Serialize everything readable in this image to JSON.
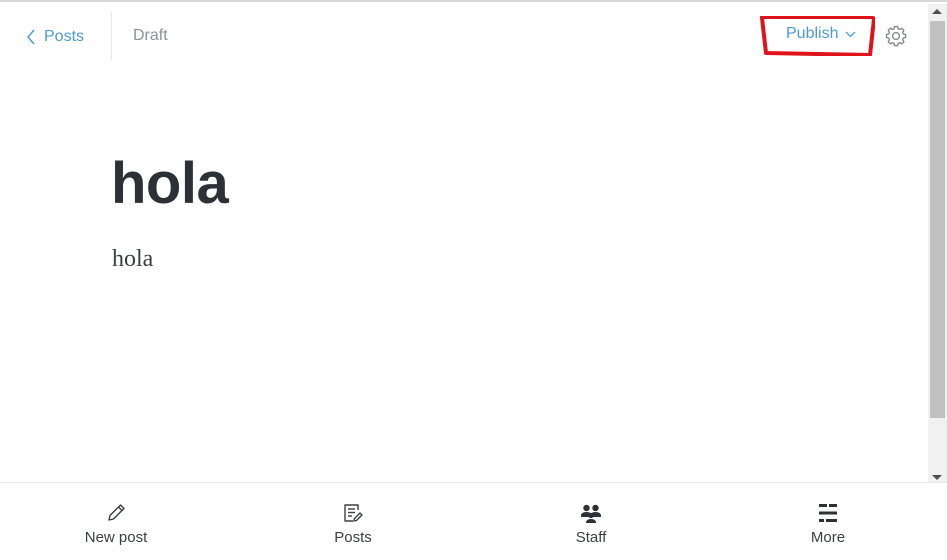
{
  "header": {
    "back_label": "Posts",
    "status_label": "Draft",
    "publish_label": "Publish"
  },
  "editor": {
    "title": "hola",
    "body": "hola"
  },
  "bottom_nav": {
    "items": [
      {
        "label": "New post",
        "icon": "pencil-icon"
      },
      {
        "label": "Posts",
        "icon": "document-icon"
      },
      {
        "label": "Staff",
        "icon": "people-icon"
      },
      {
        "label": "More",
        "icon": "menu-bars-icon"
      }
    ]
  },
  "colors": {
    "accent": "#4c9bd3",
    "title_text": "#2b3137",
    "muted_text": "#8b949b",
    "highlight_annotation": "#e0121b"
  }
}
